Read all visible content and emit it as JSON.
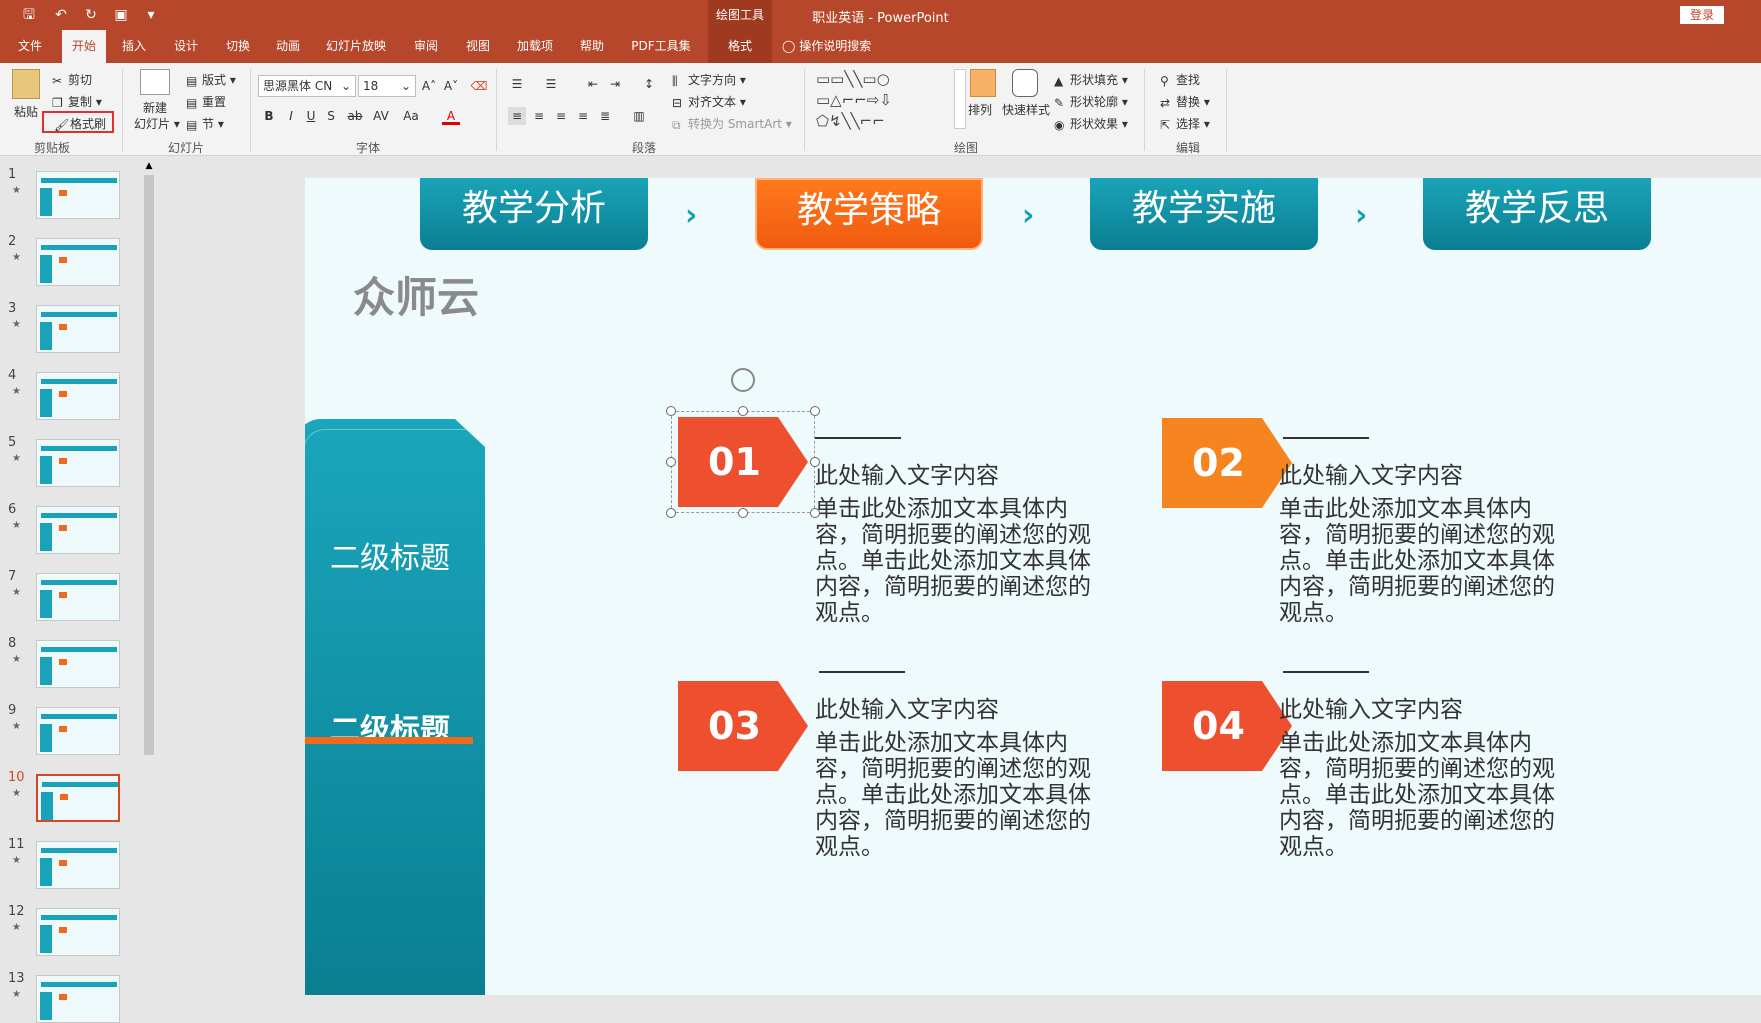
{
  "titlebar": {
    "document_title": "职业英语  -  PowerPoint",
    "context_tab_group": "绘图工具",
    "login_label": "登录"
  },
  "tabs": [
    "文件",
    "开始",
    "插入",
    "设计",
    "切换",
    "动画",
    "幻灯片放映",
    "审阅",
    "视图",
    "加载项",
    "帮助",
    "PDF工具集",
    "格式"
  ],
  "tell_me": "操作说明搜索",
  "ribbon": {
    "clipboard": {
      "paste": "粘贴",
      "cut": "剪切",
      "copy": "复制",
      "format_painter": "格式刷",
      "group": "剪贴板"
    },
    "slides": {
      "new_slide_1": "新建",
      "new_slide_2": "幻灯片",
      "layout": "版式",
      "reset": "重置",
      "section": "节",
      "group": "幻灯片"
    },
    "font": {
      "family": "思源黑体 CN",
      "size": "18",
      "group": "字体"
    },
    "paragraph": {
      "text_direction": "文字方向",
      "align_text": "对齐文本",
      "smartart": "转换为 SmartArt",
      "group": "段落"
    },
    "drawing": {
      "arrange": "排列",
      "quick_styles": "快速样式",
      "shape_fill": "形状填充",
      "shape_outline": "形状轮廓",
      "shape_effects": "形状效果",
      "group": "绘图"
    },
    "editing": {
      "find": "查找",
      "replace": "替换",
      "select": "选择",
      "group": "编辑"
    }
  },
  "thumbnails": [
    "1",
    "2",
    "3",
    "4",
    "5",
    "6",
    "7",
    "8",
    "9",
    "10",
    "11",
    "12",
    "13"
  ],
  "selected_slide": "10",
  "slide": {
    "nav": [
      "教学分析",
      "教学策略",
      "教学实施",
      "教学反思"
    ],
    "brand": "众师云",
    "side_titles": [
      "二级标题",
      "二级标题"
    ],
    "items": [
      {
        "num": "01",
        "title": "此处输入文字内容",
        "body": "单击此处添加文本具体内容，简明扼要的阐述您的观点。单击此处添加文本具体内容，简明扼要的阐述您的观点。",
        "color": "#ee4f2f"
      },
      {
        "num": "02",
        "title": "此处输入文字内容",
        "body": "单击此处添加文本具体内容，简明扼要的阐述您的观点。单击此处添加文本具体内容，简明扼要的阐述您的观点。",
        "color": "#f7851f"
      },
      {
        "num": "03",
        "title": "此处输入文字内容",
        "body": "单击此处添加文本具体内容，简明扼要的阐述您的观点。单击此处添加文本具体内容，简明扼要的阐述您的观点。",
        "color": "#ee4f2f"
      },
      {
        "num": "04",
        "title": "此处输入文字内容",
        "body": "单击此处添加文本具体内容，简明扼要的阐述您的观点。单击此处添加文本具体内容，简明扼要的阐述您的观点。",
        "color": "#ee4f2f"
      }
    ]
  },
  "colors": {
    "accent": "#b7472a",
    "teal": "#0f93a8",
    "orange": "#f06a1d"
  }
}
